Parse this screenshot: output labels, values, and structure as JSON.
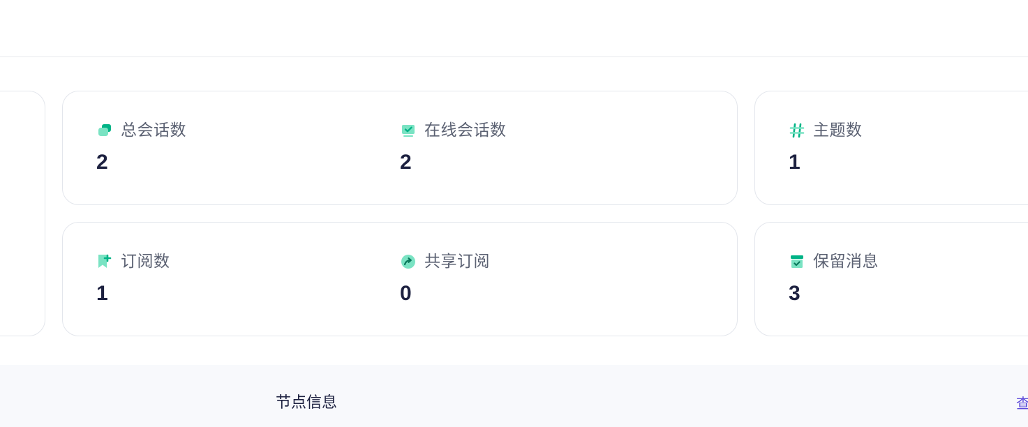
{
  "colors": {
    "accent_green": "#00b386",
    "light_green": "#7ae3c3",
    "label_gray": "#5b6172",
    "value_navy": "#1d2140",
    "link_purple": "#5b48d9"
  },
  "stats": {
    "total_sessions": {
      "label": "总会话数",
      "value": "2",
      "icon": "sessions-icon"
    },
    "online_sessions": {
      "label": "在线会话数",
      "value": "2",
      "icon": "online-monitor-icon"
    },
    "topics": {
      "label": "主题数",
      "value": "1",
      "icon": "hash-icon"
    },
    "subscriptions": {
      "label": "订阅数",
      "value": "1",
      "icon": "bookmark-plus-icon"
    },
    "shared_subscriptions": {
      "label": "共享订阅",
      "value": "0",
      "icon": "share-arrow-icon"
    },
    "retained_messages": {
      "label": "保留消息",
      "value": "3",
      "icon": "archive-box-icon"
    }
  },
  "node_section": {
    "title": "节点信息",
    "link_label": "查"
  }
}
